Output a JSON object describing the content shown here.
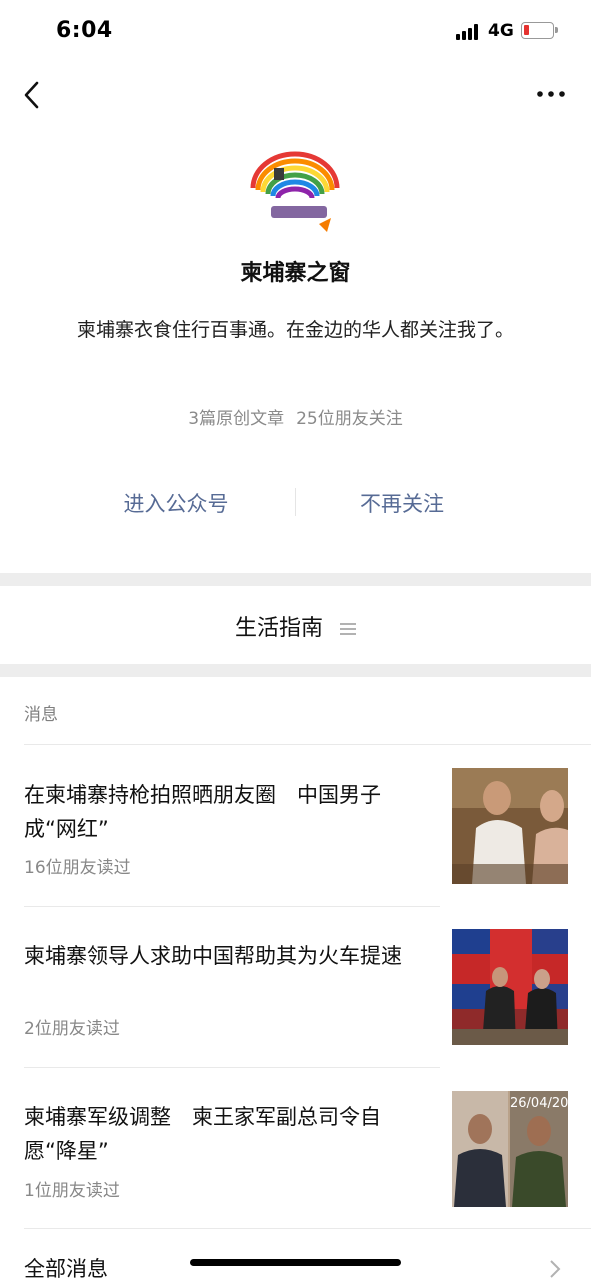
{
  "status_bar": {
    "time": "6:04",
    "network": "4G",
    "battery_level": 0.12
  },
  "nav": {
    "back_icon": "chevron-left-icon",
    "more_icon": "more-dots-icon"
  },
  "account": {
    "name": "柬埔寨之窗",
    "description": "柬埔寨衣食住行百事通。在金边的华人都关注我了。",
    "stats": {
      "articles": "3篇原创文章",
      "followers": "25位朋友关注"
    }
  },
  "actions": {
    "enter": "进入公众号",
    "unfollow": "不再关注"
  },
  "menu": {
    "title": "生活指南",
    "icon": "list-menu-icon"
  },
  "messages": {
    "section_label": "消息",
    "items": [
      {
        "title": "在柬埔寨持枪拍照晒朋友圈　中国男子成“网红”",
        "meta": "16位朋友读过"
      },
      {
        "title": "柬埔寨领导人求助中国帮助其为火车提速",
        "meta": "2位朋友读过"
      },
      {
        "title": "柬埔寨军级调整　柬王家军副总司令自愿“降星”",
        "meta": "1位朋友读过",
        "thumb_date": "26/04/20"
      }
    ],
    "all_label": "全部消息"
  },
  "colors": {
    "link": "#576b95",
    "band": "#ededed",
    "battery_low": "#e5322f"
  }
}
